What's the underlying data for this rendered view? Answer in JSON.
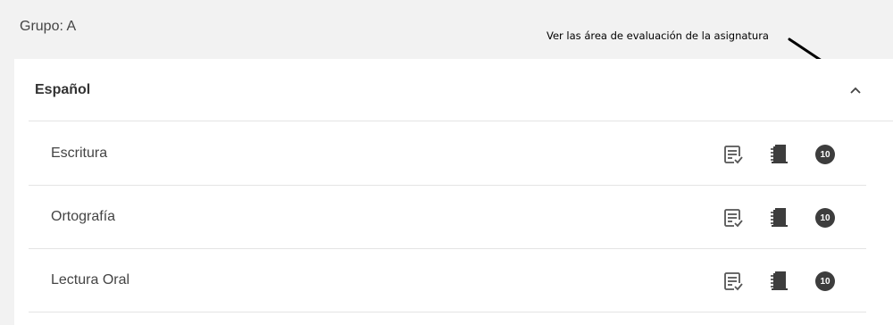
{
  "group": {
    "title": "Grupo: A"
  },
  "annotation": {
    "text": "Ver las área de evaluación de la asignatura"
  },
  "subject": {
    "title": "Español",
    "expanded": true
  },
  "areas": [
    {
      "label": "Escritura",
      "grade_badge": "10"
    },
    {
      "label": "Ortografía",
      "grade_badge": "10"
    },
    {
      "label": "Lectura Oral",
      "grade_badge": "10"
    }
  ],
  "icons": {
    "chevron": "chevron-up-icon",
    "list": "list-check-icon",
    "book": "notebook-icon",
    "grade": "grade-10-icon"
  },
  "colors": {
    "background": "#f2f2f2",
    "card": "#ffffff",
    "icon": "#555555",
    "divider": "#e4e4e4"
  }
}
